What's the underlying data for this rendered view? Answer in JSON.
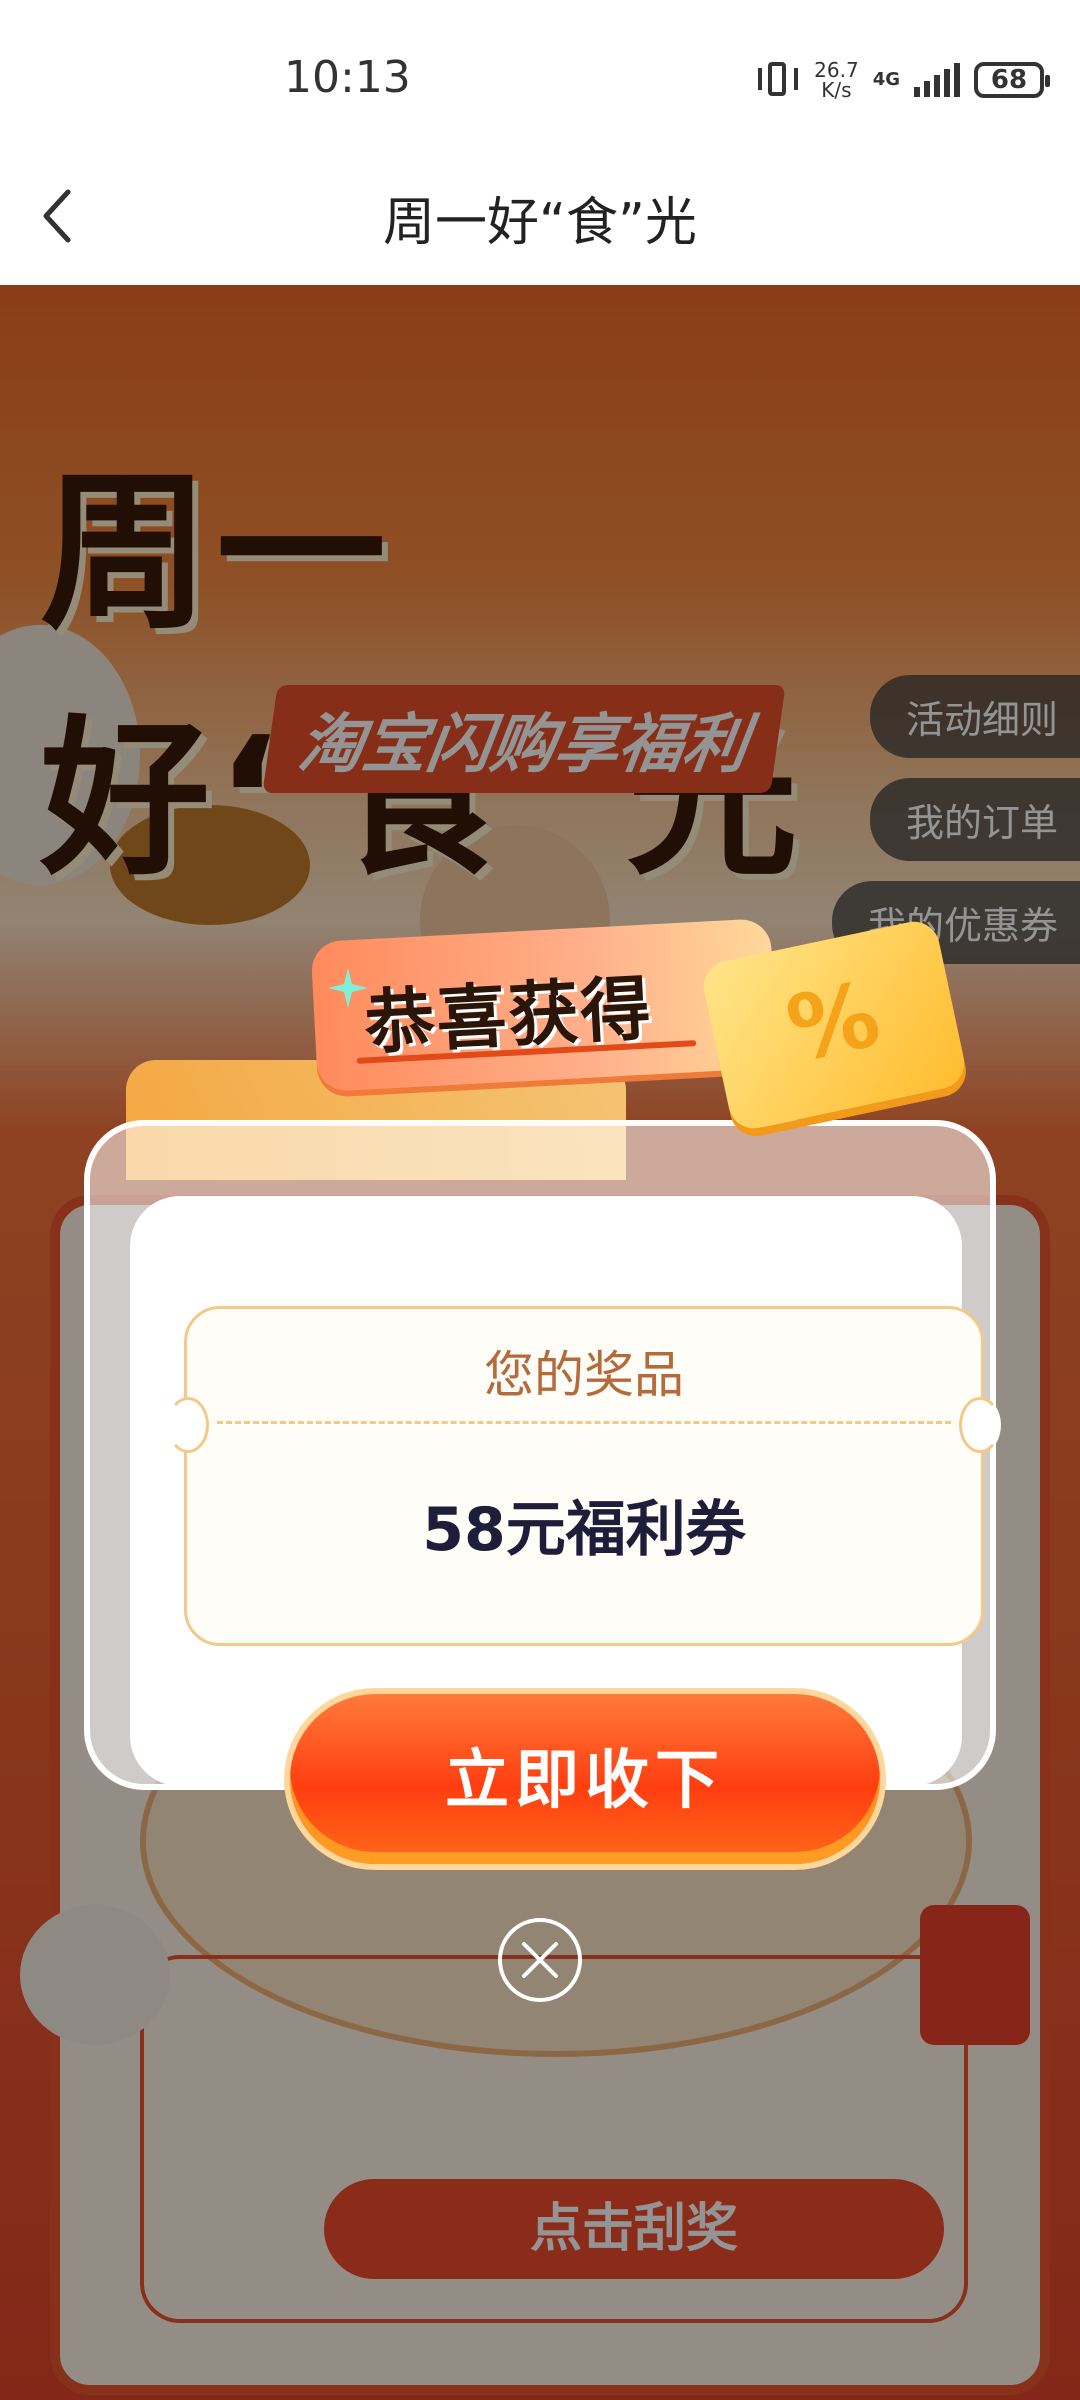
{
  "status_bar": {
    "time": "10:13",
    "speed_value": "26.7",
    "speed_unit": "K/s",
    "network": "4G",
    "battery": "68"
  },
  "header": {
    "title": "周一好“食”光",
    "back_icon": "chevron-left-icon"
  },
  "background": {
    "title": "周一好“食”光",
    "subtitle": "淘宝闪购享福利",
    "side_buttons": [
      "活动细则",
      "我的订单",
      "我的优惠券"
    ],
    "scratch_button": "点击刮奖"
  },
  "modal": {
    "banner_text": "恭喜获得",
    "ticket_symbol": "%",
    "prize_label": "您的奖品",
    "prize_value": "58元福利券",
    "claim_button": "立即收下",
    "close_icon": "close-icon"
  },
  "colors": {
    "accent": "#ff4a14",
    "prize_text": "#1e1e3a",
    "prize_label": "#b56a3a"
  }
}
